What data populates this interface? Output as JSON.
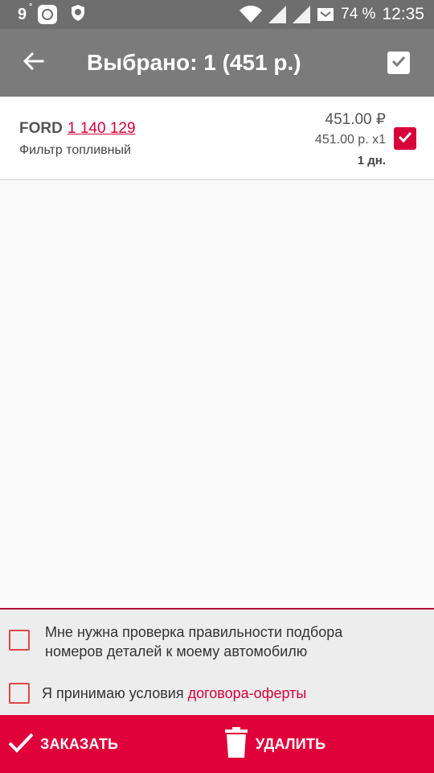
{
  "status_bar": {
    "temperature": "9",
    "degree": "°",
    "battery": "74 %",
    "time": "12:35",
    "icons": [
      "notification-icon",
      "shield-icon",
      "wifi-icon",
      "signal-icon",
      "signal-icon",
      "battery-icon"
    ]
  },
  "app_bar": {
    "title": "Выбрано: 1 (451 р.)",
    "back_icon": "arrow-left-icon",
    "select_all_icon": "checkbox-checked-icon"
  },
  "items": [
    {
      "brand": "FORD",
      "part_number": "1 140 129",
      "description": "Фильтр топливный",
      "price_total": "451.00 ₽",
      "price_unit": "451.00 р. x1",
      "delivery": "1 дн.",
      "checked": true
    }
  ],
  "options": {
    "verify_line1": "Мне нужна проверка правильности подбора",
    "verify_line2": "номеров деталей к моему автомобилю",
    "accept_prefix": "Я принимаю условия ",
    "accept_link": "договора-оферты"
  },
  "actions": {
    "order_label": "ЗАКАЗАТЬ",
    "delete_label": "УДАЛИТЬ"
  },
  "colors": {
    "accent": "#e0003a",
    "app_bar": "#7b7b7b",
    "status_bar": "#6e6e6e"
  }
}
